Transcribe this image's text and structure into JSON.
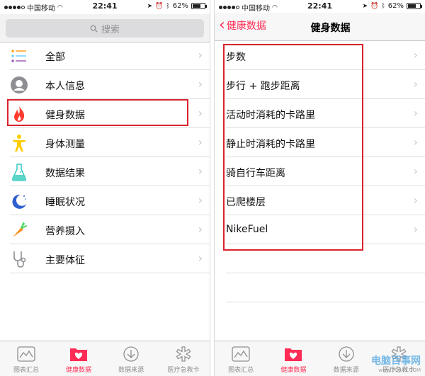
{
  "status": {
    "carrier": "中国移动",
    "time": "22:41",
    "battery": "62%",
    "battery_level": 0.62
  },
  "left": {
    "search_placeholder": "搜索",
    "items": [
      {
        "label": "全部",
        "icon": "list-icon"
      },
      {
        "label": "本人信息",
        "icon": "person-icon"
      },
      {
        "label": "健身数据",
        "icon": "flame-icon"
      },
      {
        "label": "身体测量",
        "icon": "body-icon"
      },
      {
        "label": "数据结果",
        "icon": "flask-icon"
      },
      {
        "label": "睡眠状况",
        "icon": "moon-icon"
      },
      {
        "label": "营养摄入",
        "icon": "carrot-icon"
      },
      {
        "label": "主要体征",
        "icon": "stethoscope-icon"
      }
    ]
  },
  "right": {
    "back_label": "健康数据",
    "title": "健身数据",
    "items": [
      {
        "label": "步数"
      },
      {
        "label": "步行 + 跑步距离"
      },
      {
        "label": "活动时消耗的卡路里"
      },
      {
        "label": "静止时消耗的卡路里"
      },
      {
        "label": "骑自行车距离"
      },
      {
        "label": "已爬楼层"
      },
      {
        "label": "NikeFuel"
      }
    ]
  },
  "tabs": [
    {
      "label": "图表汇总",
      "icon": "chart-icon",
      "active": false
    },
    {
      "label": "健康数据",
      "icon": "health-folder-icon",
      "active": true
    },
    {
      "label": "数据来源",
      "icon": "download-icon",
      "active": false
    },
    {
      "label": "医疗急救卡",
      "icon": "medical-star-icon",
      "active": false
    }
  ],
  "watermark": {
    "main": "电脑百事网",
    "sub": "www.PC841.COM"
  },
  "colors": {
    "accent": "#ff2d55",
    "highlight": "#d9232d"
  }
}
